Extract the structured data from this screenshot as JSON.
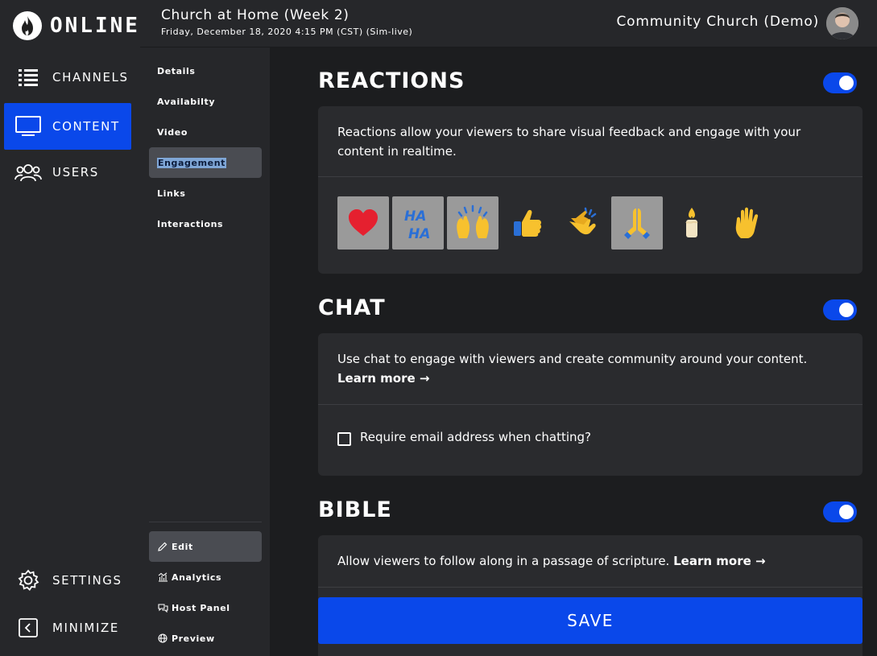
{
  "brand": {
    "name": "ONLINE",
    "logo_icon": "flame-icon"
  },
  "nav": {
    "items": [
      {
        "label": "CHANNELS",
        "icon": "list-icon",
        "active": false
      },
      {
        "label": "CONTENT",
        "icon": "monitor-icon",
        "active": true
      },
      {
        "label": "USERS",
        "icon": "users-icon",
        "active": false
      }
    ],
    "bottom": [
      {
        "label": "SETTINGS",
        "icon": "gear-icon"
      },
      {
        "label": "MINIMIZE",
        "icon": "collapse-icon"
      }
    ]
  },
  "header": {
    "title": "Church at Home (Week 2)",
    "date": "Friday, December 18, 2020 4:15 PM (CST) (Sim-live)",
    "org": "Community Church (Demo)"
  },
  "subnav": {
    "items": [
      "Details",
      "Availabilty",
      "Video",
      "Engagement",
      "Links",
      "Interactions"
    ],
    "active": "Engagement",
    "actions": [
      {
        "label": "Edit",
        "icon": "pencil-icon"
      },
      {
        "label": "Analytics",
        "icon": "analytics-icon"
      },
      {
        "label": "Host Panel",
        "icon": "chat-bubbles-icon"
      },
      {
        "label": "Preview",
        "icon": "globe-icon"
      }
    ]
  },
  "reactions": {
    "title": "REACTIONS",
    "enabled": true,
    "description": "Reactions allow your viewers to share visual feedback and engage with your content in realtime.",
    "emojis": [
      {
        "glyph": "❤️",
        "name": "heart-icon",
        "selected": true
      },
      {
        "glyph": "HA HA",
        "name": "haha-icon",
        "selected": true
      },
      {
        "glyph": "🙌",
        "name": "raised-hands-icon",
        "selected": true
      },
      {
        "glyph": "👍",
        "name": "thumbs-up-icon",
        "selected": false
      },
      {
        "glyph": "👏",
        "name": "clap-icon",
        "selected": false
      },
      {
        "glyph": "🙏",
        "name": "praying-hands-icon",
        "selected": true
      },
      {
        "glyph": "🕯️",
        "name": "candle-icon",
        "selected": false
      },
      {
        "glyph": "✋",
        "name": "raised-hand-icon",
        "selected": false
      }
    ]
  },
  "chat": {
    "title": "CHAT",
    "enabled": true,
    "description": "Use chat to engage with viewers and create community around your content.",
    "learn_more": "Learn more →",
    "checkbox_label": "Require email address when chatting?",
    "checkbox_checked": false
  },
  "bible": {
    "title": "BIBLE",
    "enabled": true,
    "description": "Allow viewers to follow along in a passage of scripture.",
    "learn_more": "Learn more →"
  },
  "save_label": "SAVE",
  "colors": {
    "accent": "#0a48ea",
    "sidebar": "#26272a",
    "background": "#1c1d1f",
    "card": "#2a2b2e"
  }
}
